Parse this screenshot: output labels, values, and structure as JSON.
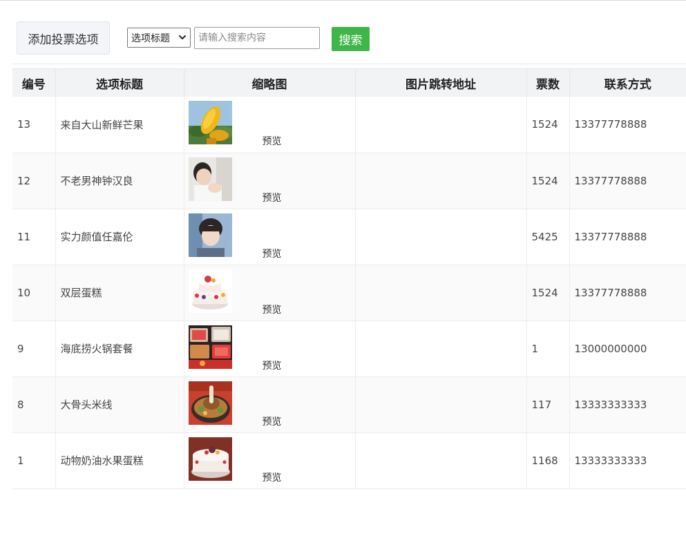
{
  "toolbar": {
    "add_label": "添加投票选项",
    "select_value": "选项标题",
    "search_placeholder": "请输入搜索内容",
    "search_label": "搜索"
  },
  "table": {
    "headers": [
      "编号",
      "选项标题",
      "缩略图",
      "图片跳转地址",
      "票数",
      "联系方式"
    ],
    "preview_label": "预览",
    "rows": [
      {
        "id": "13",
        "title": "来自大山新鲜芒果",
        "image": "mango",
        "link": "",
        "votes": "1524",
        "contact": "13377778888"
      },
      {
        "id": "12",
        "title": "不老男神钟汉良",
        "image": "man-portrait",
        "link": "",
        "votes": "1524",
        "contact": "13377778888"
      },
      {
        "id": "11",
        "title": "实力颜值任嘉伦",
        "image": "young-man-portrait",
        "link": "",
        "votes": "5425",
        "contact": "13377778888"
      },
      {
        "id": "10",
        "title": "双层蛋糕",
        "image": "double-layer-cake",
        "link": "",
        "votes": "1524",
        "contact": "13377778888"
      },
      {
        "id": "9",
        "title": "海底捞火锅套餐",
        "image": "hotpot-set",
        "link": "",
        "votes": "1",
        "contact": "13000000000"
      },
      {
        "id": "8",
        "title": "大骨头米线",
        "image": "bone-rice-noodle",
        "link": "",
        "votes": "117",
        "contact": "13333333333"
      },
      {
        "id": "1",
        "title": "动物奶油水果蛋糕",
        "image": "cream-fruit-cake",
        "link": "",
        "votes": "1168",
        "contact": "13333333333"
      }
    ]
  }
}
